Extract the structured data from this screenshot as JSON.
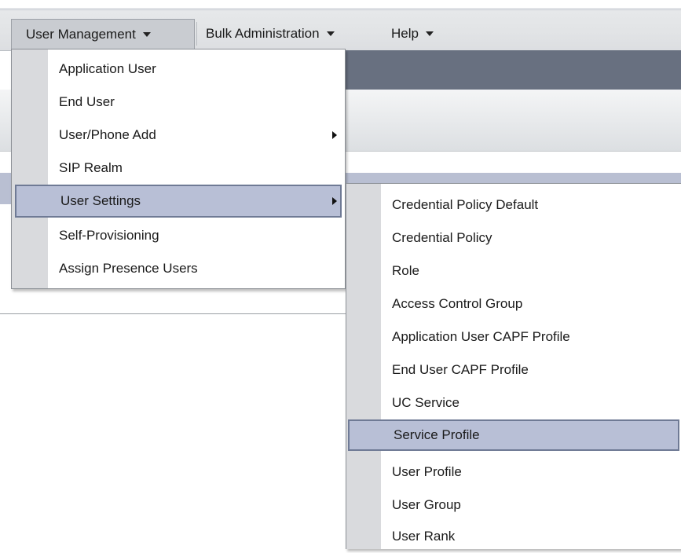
{
  "menubar": {
    "user_management": "User Management",
    "bulk_administration": "Bulk Administration",
    "help": "Help"
  },
  "user_management_menu": {
    "items": [
      {
        "label": "Application User",
        "has_submenu": false
      },
      {
        "label": "End User",
        "has_submenu": false
      },
      {
        "label": "User/Phone Add",
        "has_submenu": true
      },
      {
        "label": "SIP Realm",
        "has_submenu": false
      },
      {
        "label": "User Settings",
        "has_submenu": true,
        "highlighted": true
      },
      {
        "label": "Self-Provisioning",
        "has_submenu": false
      },
      {
        "label": "Assign Presence Users",
        "has_submenu": false
      }
    ]
  },
  "user_settings_menu": {
    "items": [
      {
        "label": "Credential Policy Default"
      },
      {
        "label": "Credential Policy"
      },
      {
        "label": "Role"
      },
      {
        "label": "Access Control Group"
      },
      {
        "label": "Application User CAPF Profile"
      },
      {
        "label": "End User CAPF Profile"
      },
      {
        "label": "UC Service"
      },
      {
        "label": "Service Profile",
        "highlighted": true
      },
      {
        "label": "User Profile"
      },
      {
        "label": "User Group"
      },
      {
        "label": "User Rank"
      }
    ]
  },
  "colors": {
    "highlight_fill": "#b8bfd6",
    "highlight_border": "#6f7a95",
    "menu_gutter": "#d9dadd",
    "header_dark": "#687080"
  }
}
